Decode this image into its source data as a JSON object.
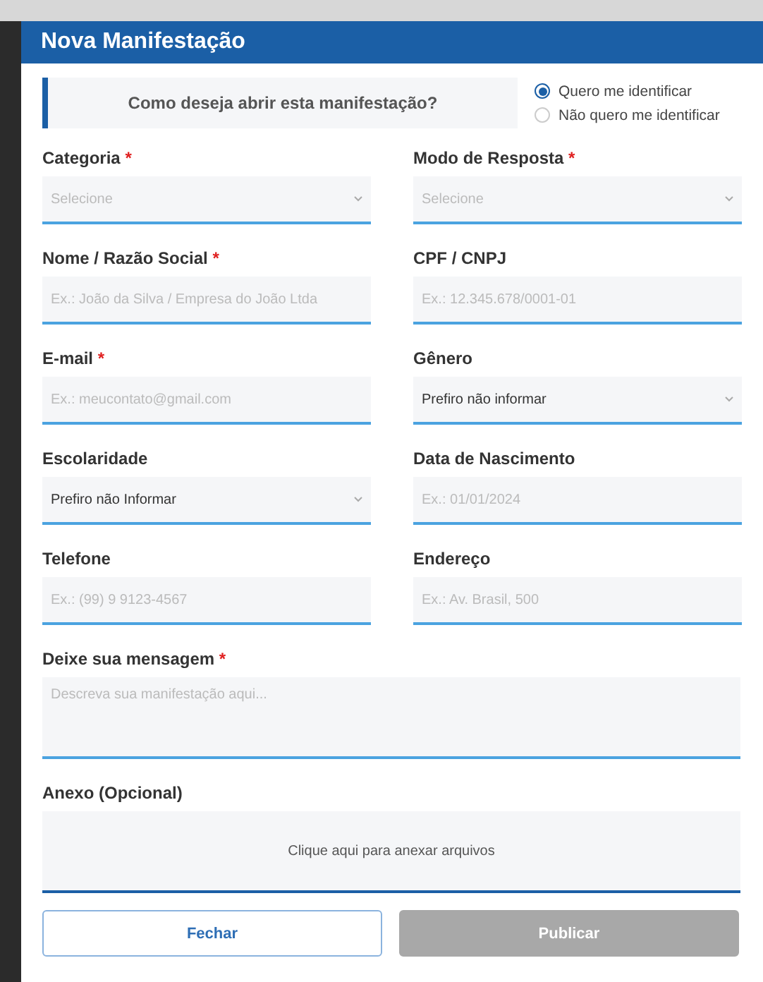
{
  "dialog": {
    "title": "Nova Manifestação"
  },
  "identification": {
    "question": "Como deseja abrir esta manifestação?",
    "options": [
      {
        "label": "Quero me identificar",
        "selected": true
      },
      {
        "label": "Não quero me identificar",
        "selected": false
      }
    ]
  },
  "fields": [
    {
      "label": "Categoria",
      "required_mark": "*",
      "kind": "select",
      "placeholder": "Selecione"
    },
    {
      "label": "Modo de Resposta",
      "required_mark": "*",
      "kind": "select",
      "placeholder": "Selecione"
    },
    {
      "label": "Nome / Razão Social",
      "required_mark": "*",
      "kind": "text",
      "placeholder": "Ex.: João da Silva / Empresa do João Ltda"
    },
    {
      "label": "CPF / CNPJ",
      "kind": "text",
      "placeholder": "Ex.: 12.345.678/0001-01"
    },
    {
      "label": "E-mail",
      "required_mark": "*",
      "kind": "text",
      "placeholder": "Ex.: meucontato@gmail.com"
    },
    {
      "label": "Gênero",
      "kind": "select",
      "value": "Prefiro não informar"
    },
    {
      "label": "Escolaridade",
      "kind": "select",
      "value": "Prefiro não Informar"
    },
    {
      "label": "Data de Nascimento",
      "kind": "text",
      "placeholder": "Ex.: 01/01/2024"
    },
    {
      "label": "Telefone",
      "kind": "text",
      "placeholder": "Ex.: (99) 9 9123-4567"
    },
    {
      "label": "Endereço",
      "kind": "text",
      "placeholder": "Ex.: Av. Brasil, 500"
    }
  ],
  "message": {
    "label": "Deixe sua mensagem",
    "required_mark": "*",
    "placeholder": "Descreva sua manifestação aqui..."
  },
  "attachment": {
    "label": "Anexo (Opcional)",
    "prompt": "Clique aqui para anexar arquivos"
  },
  "buttons": [
    {
      "label": "Fechar",
      "disabled": false
    },
    {
      "label": "Publicar",
      "disabled": true
    }
  ]
}
